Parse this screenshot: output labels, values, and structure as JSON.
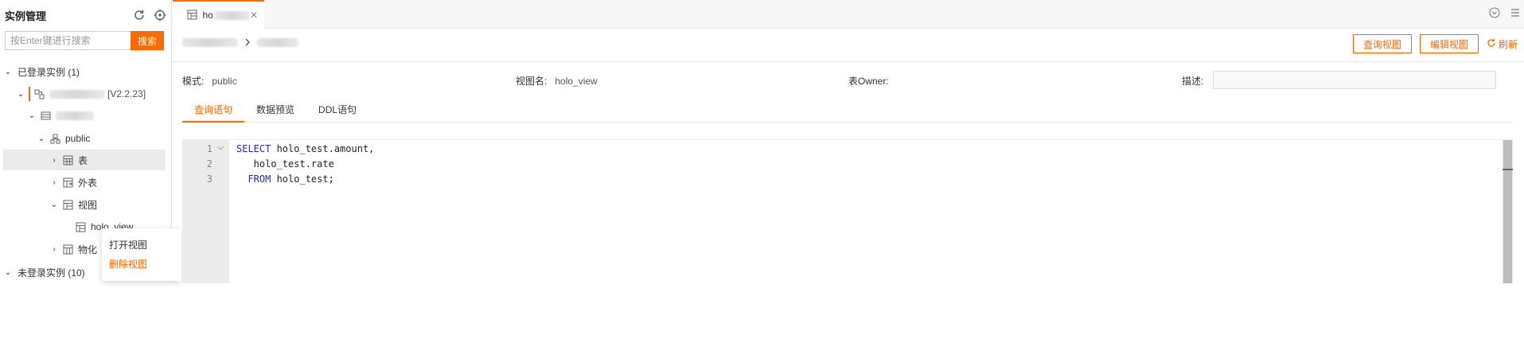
{
  "sidebar": {
    "title": "实例管理",
    "search_placeholder": "按Enter键进行搜索",
    "search_button": "搜索",
    "tree": {
      "logged_in": "已登录实例 (1)",
      "instance_version": "[V2.2.23]",
      "schema": "public",
      "tables": "表",
      "foreign_tables": "外表",
      "views": "视图",
      "view_item": "holo_view",
      "materialized": "物化",
      "not_logged_in": "未登录实例 (10)"
    },
    "context_menu": {
      "open_view": "打开视图",
      "delete_view": "删除视图"
    }
  },
  "tabbar": {
    "tab_label": "ho"
  },
  "actions": {
    "query_view": "查询视图",
    "edit_view": "编辑视图",
    "refresh": "刷新"
  },
  "meta": {
    "schema_label": "模式:",
    "schema_value": "public",
    "view_name_label": "视图名:",
    "view_name_value": "holo_view",
    "owner_label": "表Owner:",
    "desc_label": "描述:"
  },
  "inner_tabs": [
    "查询语句",
    "数据预览",
    "DDL语句"
  ],
  "editor": {
    "lines": [
      {
        "no": "1",
        "kw": "SELECT",
        "rest": " holo_test.amount,"
      },
      {
        "no": "2",
        "kw": "",
        "rest": "   holo_test.rate"
      },
      {
        "no": "3",
        "kw": "  FROM",
        "rest": " holo_test;"
      }
    ]
  },
  "colors": {
    "accent": "#ff6a00",
    "keyword": "#2a2ab8"
  }
}
